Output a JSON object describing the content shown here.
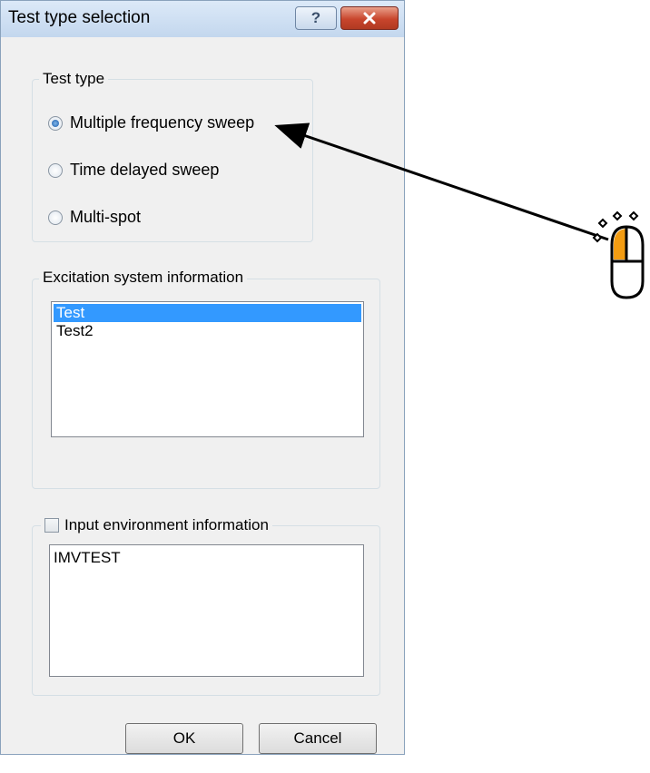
{
  "dialog": {
    "title": "Test type selection",
    "help_glyph": "?",
    "close_icon": "close-x-icon"
  },
  "test_type": {
    "legend": "Test type",
    "options": [
      {
        "label": "Multiple frequency sweep",
        "selected": true
      },
      {
        "label": "Time delayed sweep",
        "selected": false
      },
      {
        "label": "Multi-spot",
        "selected": false
      }
    ]
  },
  "excitation": {
    "legend": "Excitation system information",
    "items": [
      {
        "label": "Test",
        "selected": true
      },
      {
        "label": "Test2",
        "selected": false
      }
    ]
  },
  "environment": {
    "checkbox_label": "Input environment information",
    "checked": false,
    "text": "IMVTEST"
  },
  "buttons": {
    "ok": "OK",
    "cancel": "Cancel"
  },
  "colors": {
    "selection": "#3399ff",
    "mouse_button_highlight": "#f39c12"
  },
  "annotation": {
    "icon": "mouse-left-click-icon"
  }
}
